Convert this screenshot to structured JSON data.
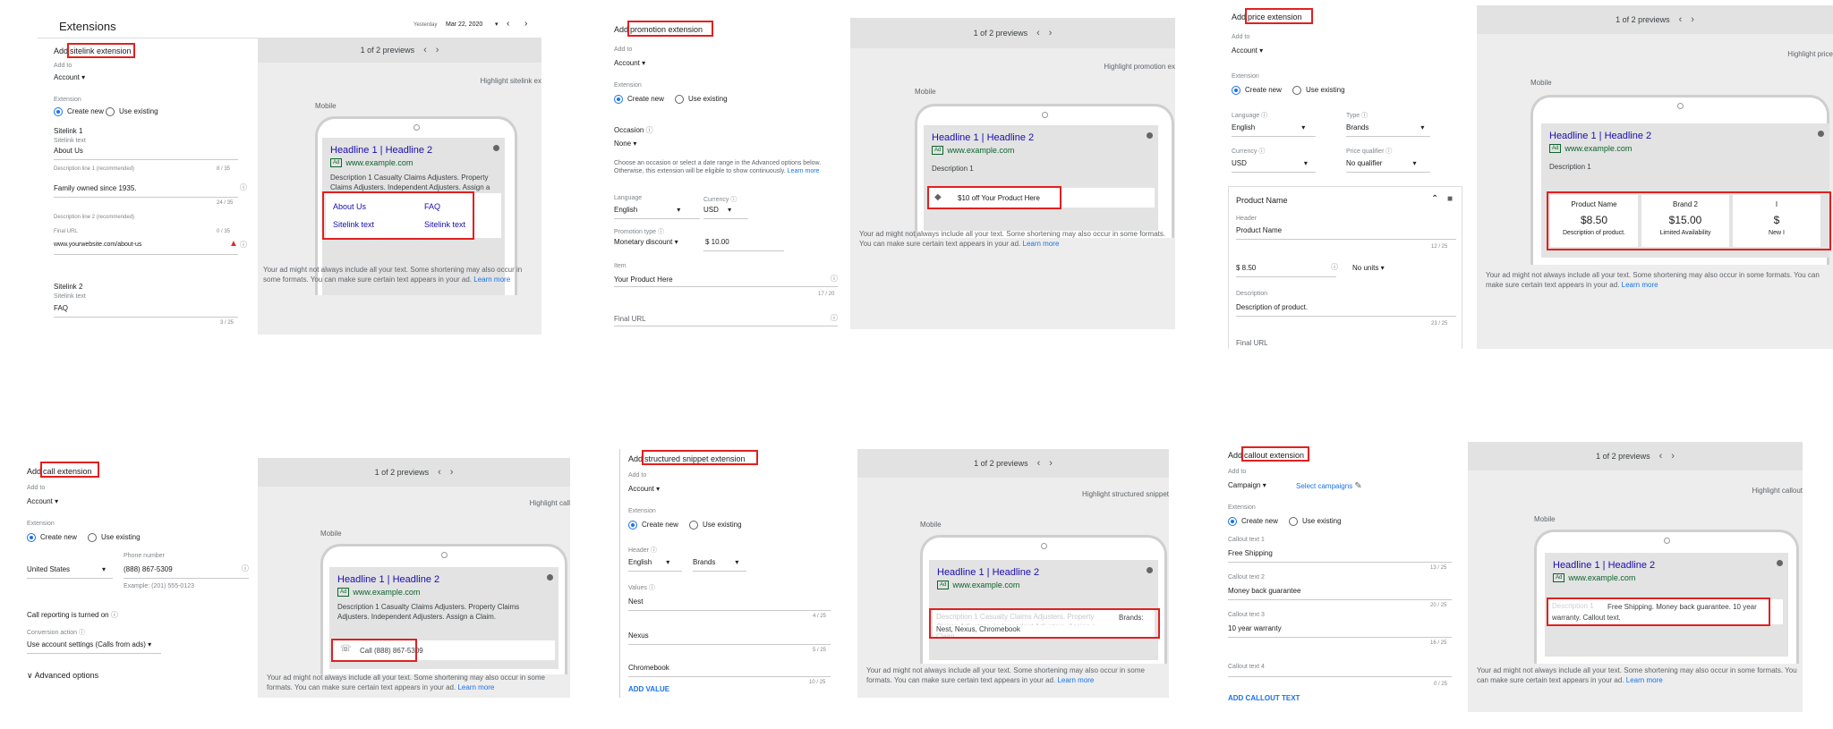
{
  "common": {
    "previews": "1 of 2 previews",
    "add_to": "Add to",
    "extension": "Extension",
    "create_new": "Create new",
    "use_existing": "Use existing",
    "mobile": "Mobile",
    "headline": "Headline 1 | Headline 2",
    "ad_badge": "Ad",
    "url": "www.example.com",
    "desc_long": "Description 1 Casualty Claims Adjusters. Property Claims Adjusters. Independent Adjusters. Assign a Claim.",
    "description_1": "Description 1",
    "footer": "Your ad might not always include all your text. Some shortening may also occur in some formats. You can make sure certain text appears in your ad.",
    "learn_more": "Learn more"
  },
  "sitelink": {
    "header_title": "Extensions",
    "date_label": "Yesterday",
    "date_value": "Mar 22, 2020",
    "add_prefix": "Add",
    "title": "sitelink extension",
    "account": "Account",
    "sitelink1": "Sitelink 1",
    "sitelink_text_label": "Sitelink text",
    "sitelink1_text": "About Us",
    "desc1_label": "Description line 1 (recommended)",
    "desc1_count": "8 / 35",
    "desc1_value": "Family owned since 1935.",
    "desc1_count2": "24 / 35",
    "desc2_label": "Description line 2 (recommended)",
    "final_url_label": "Final URL",
    "desc2_count": "0 / 35",
    "final_url_value": "www.yourwebsite.com/about-us",
    "sitelink2": "Sitelink 2",
    "sitelink2_text": "FAQ",
    "sitelink2_count": "3 / 25",
    "highlight": "Highlight sitelink ex",
    "links": [
      "About Us",
      "FAQ",
      "Sitelink text",
      "Sitelink text"
    ]
  },
  "promotion": {
    "add_prefix": "Add",
    "title": "promotion extension",
    "account": "Account",
    "occasion_label": "Occasion",
    "occasion_value": "None",
    "help_text": "Choose an occasion or select a date range in the Advanced options below. Otherwise, this extension will be eligible to show continuously.",
    "learn_more": "Learn more",
    "language_label": "Language",
    "language_value": "English",
    "currency_label": "Currency",
    "currency_value": "USD",
    "promo_type_label": "Promotion type",
    "promo_type_value": "Monetary discount",
    "amount": "$ 10.00",
    "item_label": "Item",
    "item_value": "Your Product Here",
    "item_count": "17 / 20",
    "final_url": "Final URL",
    "highlight": "Highlight promotion ex",
    "ext_text": "$10 off Your Product Here"
  },
  "price": {
    "add_prefix": "Add",
    "title": "price extension",
    "account": "Account",
    "language_label": "Language",
    "language_value": "English",
    "type_label": "Type",
    "type_value": "Brands",
    "currency_label": "Currency",
    "currency_value": "USD",
    "qualifier_label": "Price qualifier",
    "qualifier_value": "No qualifier",
    "item_title": "Product Name",
    "header_label": "Header",
    "header_value": "Product Name",
    "header_count": "12 / 25",
    "price_value": "$ 8.50",
    "units_value": "No units",
    "description_label": "Description",
    "description_value": "Description of product.",
    "description_count": "23 / 25",
    "final_url": "Final URL",
    "highlight": "Highlight price",
    "cards": [
      {
        "name": "Product Name",
        "price": "$8.50",
        "desc": "Description of product."
      },
      {
        "name": "Brand 2",
        "price": "$15.00",
        "desc": "Limited Availability"
      },
      {
        "name": "I",
        "price": "$",
        "desc": "New I"
      }
    ]
  },
  "call": {
    "add_prefix": "Add",
    "title": "call extension",
    "account": "Account",
    "country": "United States",
    "phone_label": "Phone number",
    "phone_value": "(888) 867-5309",
    "example": "Example: (201) 555-0123",
    "reporting": "Call reporting is turned on",
    "conversion_label": "Conversion action",
    "conversion_value": "Use account settings (Calls from ads)",
    "advanced": "Advanced options",
    "highlight": "Highlight call",
    "ext_text": "Call (888) 867-5309"
  },
  "snippet": {
    "add_prefix": "Add",
    "title": "structured snippet extension",
    "account": "Account",
    "header_label": "Header",
    "lang_value": "English",
    "header_value": "Brands",
    "values_label": "Values",
    "values": [
      "Nest",
      "Nexus",
      "Chromebook"
    ],
    "counts": [
      "4 / 25",
      "5 / 25",
      "10 / 25"
    ],
    "add_value": "ADD VALUE",
    "highlight": "Highlight structured snippet",
    "ext_faded": "Description 1 Casualty Claims Adjusters. Property Claims Adjusters. Independent Adjusters. Assign a Claim.",
    "ext_brands": "Brands:",
    "ext_values": "Nest, Nexus, Chromebook"
  },
  "callout": {
    "add_prefix": "Add",
    "title": "callout extension",
    "campaign": "Campaign",
    "select_campaigns": "Select campaigns",
    "labels": [
      "Callout text 1",
      "Callout text 2",
      "Callout text 3",
      "Callout text 4"
    ],
    "values": [
      "Free Shipping",
      "Money back guarantee",
      "10 year warranty",
      ""
    ],
    "counts": [
      "13 / 25",
      "20 / 25",
      "16 / 25",
      "0 / 25"
    ],
    "add_text": "ADD CALLOUT TEXT",
    "highlight": "Highlight callout",
    "ext_faded": "Description 1",
    "ext_text": "Free Shipping. Money back guarantee. 10 year warranty. Callout text."
  }
}
